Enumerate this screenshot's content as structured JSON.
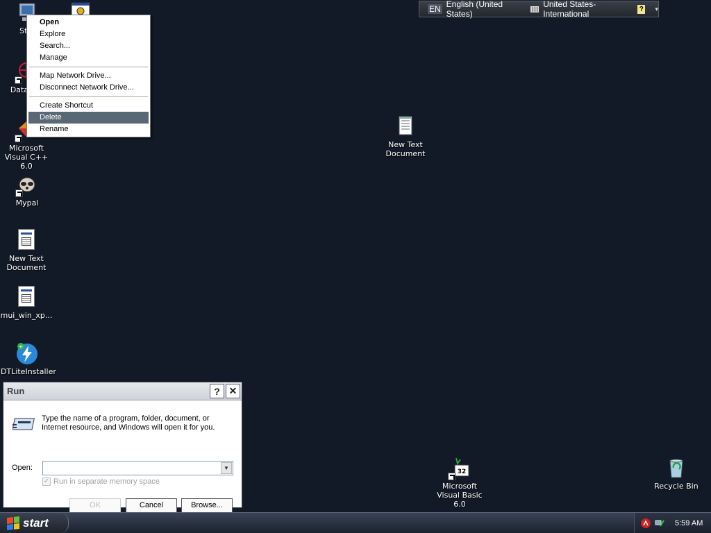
{
  "desktop": {
    "icons": [
      {
        "label": "St...",
        "name": "my-computer"
      },
      {
        "label": "DataW...",
        "name": "datawatch"
      },
      {
        "label": "Microsoft Visual C++ 6.0",
        "name": "msvc6"
      },
      {
        "label": "Mypal",
        "name": "mypal"
      },
      {
        "label": "New Text Document",
        "name": "new-text-document-left"
      },
      {
        "label": "mui_win_xp...",
        "name": "mui-win-xp"
      },
      {
        "label": "DTLiteInstaller",
        "name": "dtlite-installer"
      },
      {
        "label": "New Text Document",
        "name": "new-text-document-center"
      },
      {
        "label": "Microsoft Visual Basic 6.0",
        "name": "msvb6"
      },
      {
        "label": "Recycle Bin",
        "name": "recycle-bin"
      }
    ]
  },
  "langbar": {
    "lang_code": "EN",
    "language": "English (United States)",
    "keyboard": "United States-International",
    "help": "?",
    "options": "▾"
  },
  "context_menu": {
    "items": [
      "Open",
      "Explore",
      "Search...",
      "Manage",
      "Map Network Drive...",
      "Disconnect Network Drive...",
      "Create Shortcut",
      "Delete",
      "Rename"
    ],
    "highlighted": "Delete"
  },
  "run_dialog": {
    "title": "Run",
    "help_btn": "?",
    "close_btn": "✕",
    "description": "Type the name of a program, folder, document, or Internet resource, and Windows will open it for you.",
    "open_label": "Open:",
    "open_value": "",
    "checkbox_label": "Run in separate memory space",
    "checkbox_checked": true,
    "ok_label": "OK",
    "cancel_label": "Cancel",
    "browse_label": "Browse..."
  },
  "taskbar": {
    "start_label": "start",
    "clock": "5:59 AM"
  }
}
